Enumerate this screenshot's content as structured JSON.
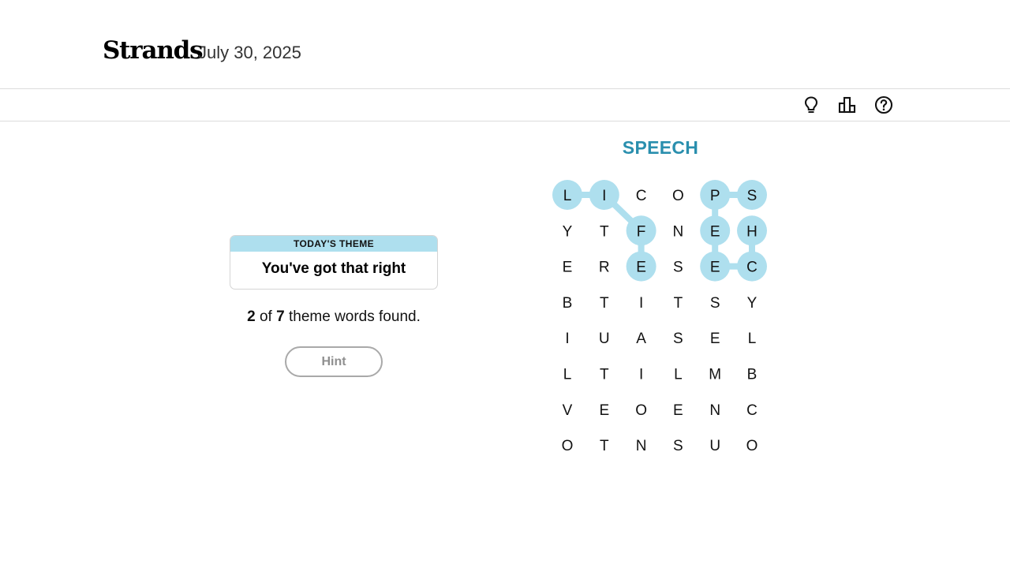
{
  "header": {
    "title": "Strands",
    "date": "July 30, 2025"
  },
  "toolbar": {
    "icons": [
      "lightbulb-icon",
      "leaderboard-icon",
      "help-icon"
    ]
  },
  "theme": {
    "heading": "TODAY'S THEME",
    "clue": "You've got that right"
  },
  "progress": {
    "found": "2",
    "of_text": "of",
    "total": "7",
    "suffix": "theme words found."
  },
  "hint": {
    "label": "Hint",
    "enabled": false
  },
  "current_word": "SPEECH",
  "colors": {
    "highlight": "#aedfee",
    "title_blue": "#2a8fae",
    "theme_header": "#aedfee"
  },
  "grid": {
    "rows": [
      [
        "L",
        "I",
        "C",
        "O",
        "P",
        "S"
      ],
      [
        "Y",
        "T",
        "F",
        "N",
        "E",
        "H"
      ],
      [
        "E",
        "R",
        "E",
        "S",
        "E",
        "C"
      ],
      [
        "B",
        "T",
        "I",
        "T",
        "S",
        "Y"
      ],
      [
        "I",
        "U",
        "A",
        "S",
        "E",
        "L"
      ],
      [
        "L",
        "T",
        "I",
        "L",
        "M",
        "B"
      ],
      [
        "V",
        "E",
        "O",
        "E",
        "N",
        "C"
      ],
      [
        "O",
        "T",
        "N",
        "S",
        "U",
        "O"
      ]
    ]
  },
  "found_paths": [
    {
      "word": "LIFE",
      "cells": [
        [
          0,
          0
        ],
        [
          0,
          1
        ],
        [
          1,
          2
        ],
        [
          2,
          2
        ]
      ]
    },
    {
      "word": "SPEECH",
      "cells": [
        [
          0,
          5
        ],
        [
          0,
          4
        ],
        [
          1,
          4
        ],
        [
          2,
          4
        ],
        [
          2,
          5
        ],
        [
          1,
          5
        ]
      ]
    }
  ]
}
